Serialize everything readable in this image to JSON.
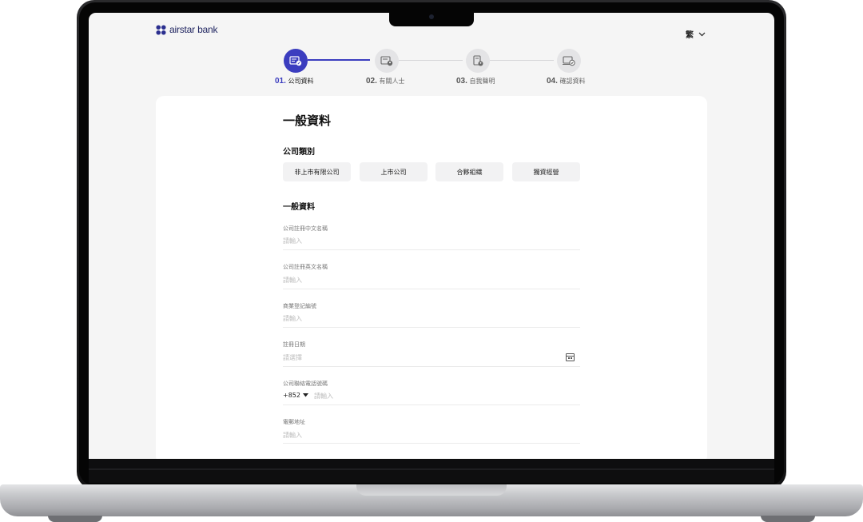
{
  "app": {
    "brand": "airstar bank",
    "language": "繁"
  },
  "stepper": {
    "steps": [
      {
        "num": "01.",
        "label": "公司資料",
        "active": true
      },
      {
        "num": "02.",
        "label": "有關人士",
        "active": false
      },
      {
        "num": "03.",
        "label": "自我聲明",
        "active": false
      },
      {
        "num": "04.",
        "label": "確認資料",
        "active": false
      }
    ]
  },
  "form": {
    "title": "一般資料",
    "company_type": {
      "label": "公司類別",
      "options": [
        "非上市有限公司",
        "上市公司",
        "合夥組織",
        "獨資經營"
      ]
    },
    "general_section": "一般資料",
    "fields": [
      {
        "label": "公司註冊中文名稱",
        "placeholder": "請輸入"
      },
      {
        "label": "公司註冊英文名稱",
        "placeholder": "請輸入"
      },
      {
        "label": "商業登記編號",
        "placeholder": "請輸入"
      },
      {
        "label": "註冊日期",
        "placeholder": "請選擇",
        "icon": "calendar-icon"
      },
      {
        "label": "公司聯絡電話號碼",
        "placeholder": "請輸入",
        "prefix": "+852"
      },
      {
        "label": "電郵地址",
        "placeholder": "請輸入"
      }
    ]
  },
  "colors": {
    "accent": "#3b3dbf",
    "background": "#f5f5f5"
  }
}
